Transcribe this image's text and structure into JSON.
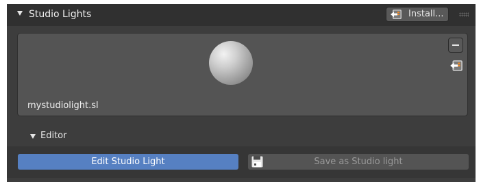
{
  "panel": {
    "title": "Studio Lights",
    "install_label": "Install...",
    "file_name": "mystudiolight.sl"
  },
  "editor": {
    "title": "Editor",
    "edit_label": "Edit Studio Light",
    "save_label": "Save as Studio light"
  },
  "icons": {
    "header_toggle": "disclosure-triangle-down-icon",
    "install": "import-icon",
    "remove": "minus-icon",
    "import": "import-icon",
    "save": "floppy-disk-icon"
  },
  "colors": {
    "accent": "#5680c2",
    "panel_background": "#3d3d3d",
    "header_background": "#303030"
  }
}
